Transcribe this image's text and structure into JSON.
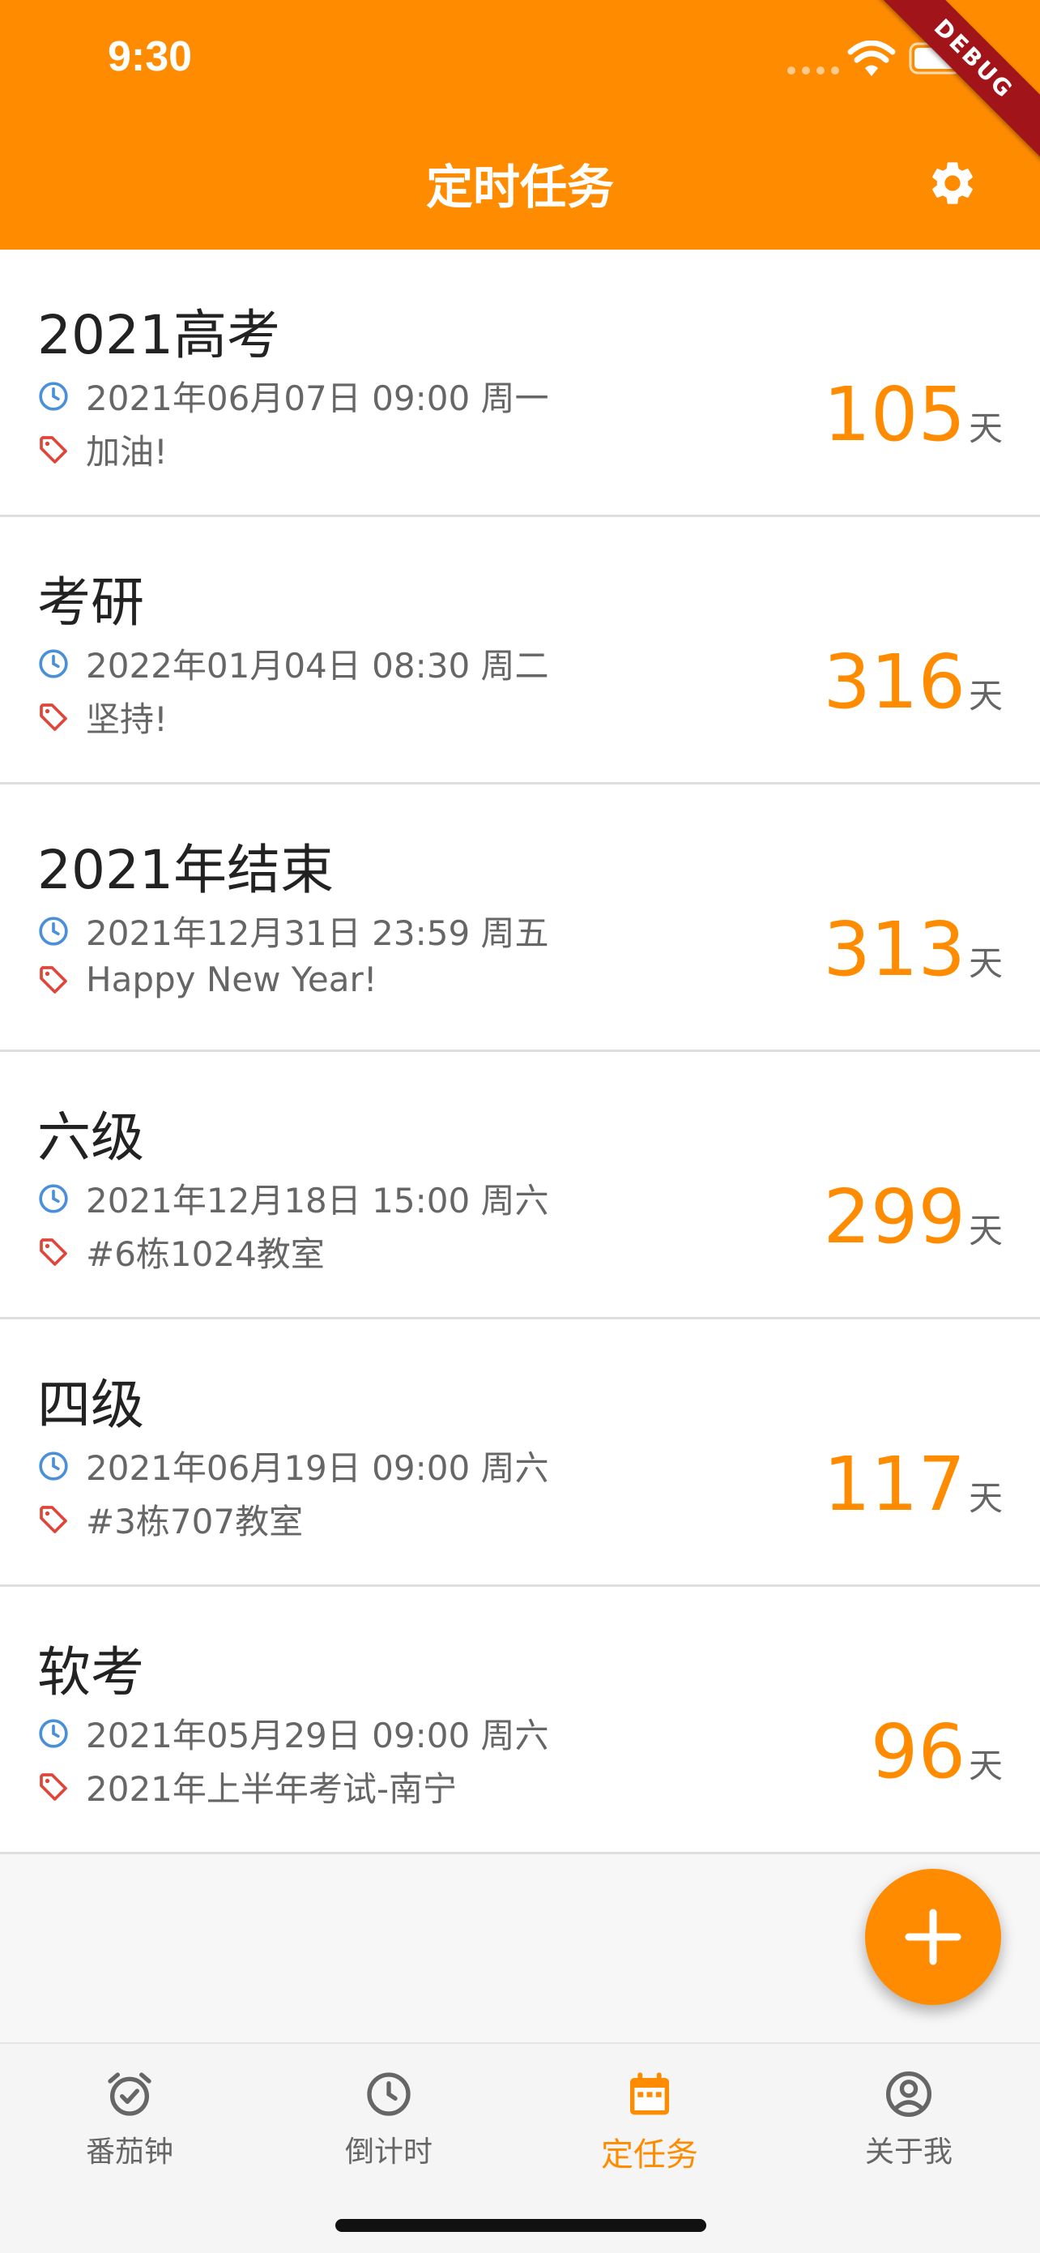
{
  "status_bar": {
    "time": "9:30"
  },
  "debug_banner": "DEBUG",
  "appbar": {
    "title": "定时任务",
    "settings_icon": "settings-icon"
  },
  "colors": {
    "accent": "#ff8c00",
    "clock_icon": "#4a90d9",
    "tag_icon": "#e0453a"
  },
  "tasks": [
    {
      "title": "2021高考",
      "datetime": "2021年06月07日 09:00 周一",
      "note": "加油!",
      "days": "105",
      "unit": "天"
    },
    {
      "title": "考研",
      "datetime": "2022年01月04日 08:30 周二",
      "note": "坚持!",
      "days": "316",
      "unit": "天"
    },
    {
      "title": "2021年结束",
      "datetime": "2021年12月31日 23:59 周五",
      "note": "Happy New Year!",
      "days": "313",
      "unit": "天"
    },
    {
      "title": "六级",
      "datetime": "2021年12月18日 15:00 周六",
      "note": "#6栋1024教室",
      "days": "299",
      "unit": "天"
    },
    {
      "title": "四级",
      "datetime": "2021年06月19日 09:00 周六",
      "note": "#3栋707教室",
      "days": "117",
      "unit": "天"
    },
    {
      "title": "软考",
      "datetime": "2021年05月29日 09:00 周六",
      "note": "2021年上半年考试-南宁",
      "days": "96",
      "unit": "天"
    }
  ],
  "fab": {
    "icon": "plus-icon"
  },
  "bottom_nav": [
    {
      "label": "番茄钟",
      "icon": "alarm-icon",
      "active": false
    },
    {
      "label": "倒计时",
      "icon": "clock-icon",
      "active": false
    },
    {
      "label": "定任务",
      "icon": "calendar-icon",
      "active": true
    },
    {
      "label": "关于我",
      "icon": "account-icon",
      "active": false
    }
  ]
}
